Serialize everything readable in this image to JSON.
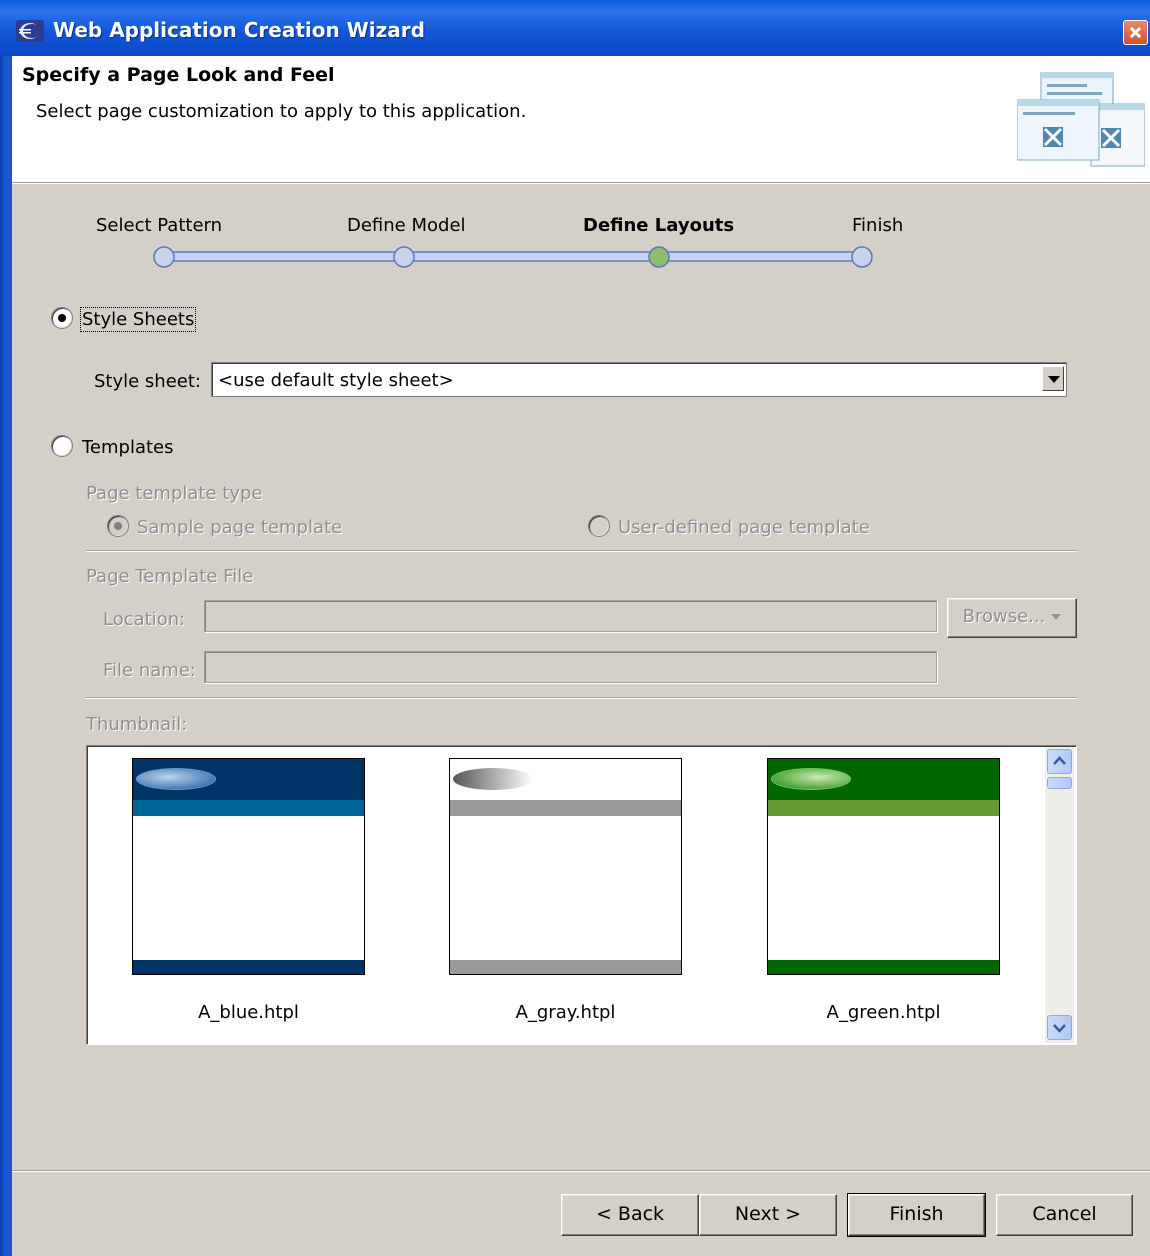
{
  "window": {
    "title": "Web Application Creation Wizard"
  },
  "header": {
    "title": "Specify a Page Look and Feel",
    "description": "Select page customization to apply to this application."
  },
  "steps": {
    "items": [
      "Select Pattern",
      "Define Model",
      "Define Layouts",
      "Finish"
    ],
    "current_index": 2
  },
  "style_sheets": {
    "radio_label": "Style Sheets",
    "selected": true,
    "field_label": "Style sheet:",
    "value": "<use default style sheet>"
  },
  "templates": {
    "radio_label": "Templates",
    "selected": false,
    "page_template_type_label": "Page template type",
    "sample_option": "Sample page template",
    "user_defined_option": "User-defined page template",
    "page_template_file_label": "Page Template File",
    "location_label": "Location:",
    "location_value": "",
    "browse_label": "Browse...",
    "file_name_label": "File name:",
    "file_name_value": "",
    "thumbnail_label": "Thumbnail:",
    "thumbnails": [
      {
        "name": "A_blue.htpl",
        "header_color": "#003366",
        "band_color": "#006699",
        "footer_color": "#003366"
      },
      {
        "name": "A_gray.htpl",
        "header_color": "#ffffff",
        "band_color": "#999999",
        "footer_color": "#999999"
      },
      {
        "name": "A_green.htpl",
        "header_color": "#006600",
        "band_color": "#669933",
        "footer_color": "#006600"
      }
    ]
  },
  "buttons": {
    "back": "< Back",
    "next": "Next >",
    "finish": "Finish",
    "cancel": "Cancel"
  }
}
